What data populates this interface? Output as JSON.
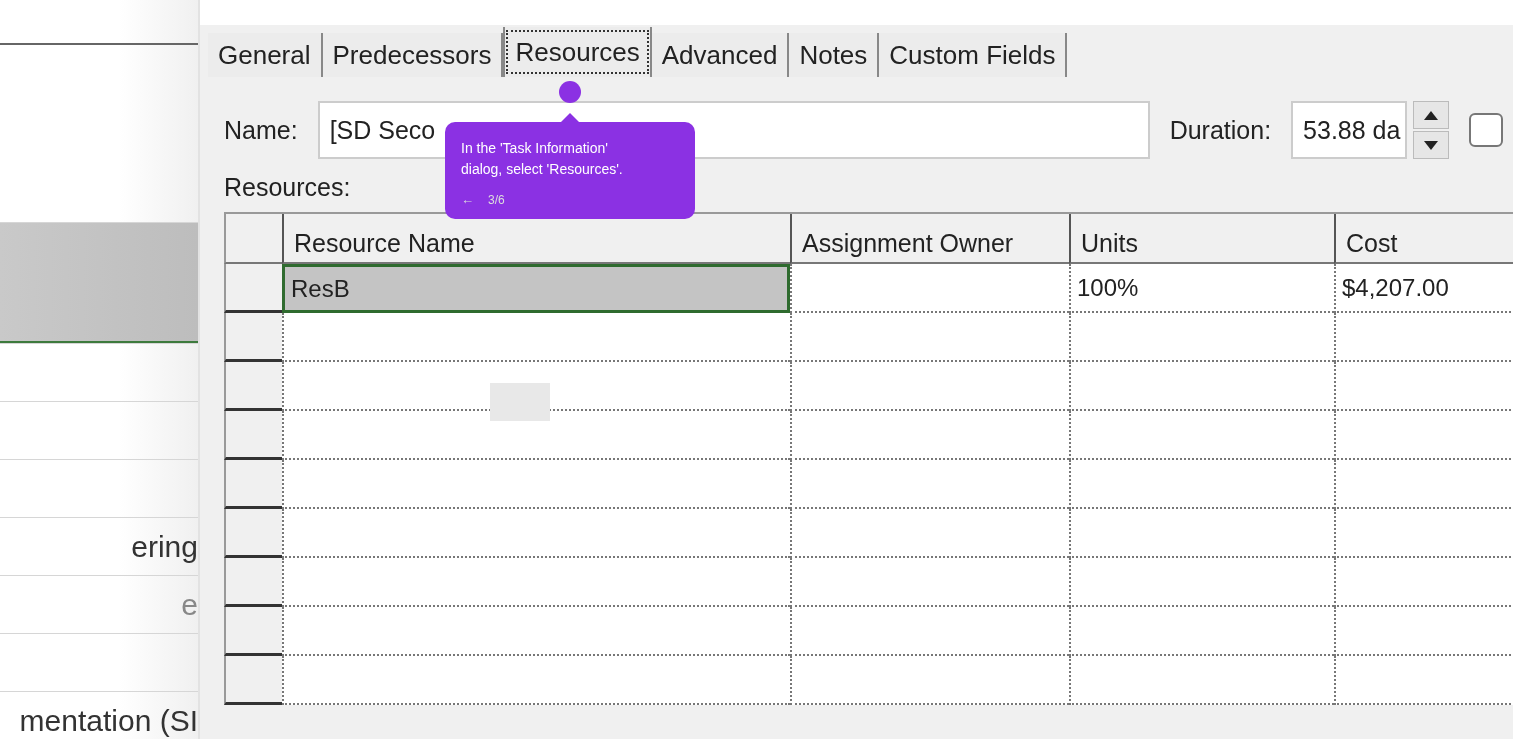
{
  "background_list": {
    "rows": [
      {
        "text": "",
        "selected": false
      },
      {
        "text": "",
        "selected": true
      },
      {
        "text": "",
        "selected": false
      },
      {
        "text": "",
        "selected": false
      },
      {
        "text": "",
        "selected": false
      },
      {
        "text": "ering",
        "selected": false
      },
      {
        "text": "e",
        "selected": false
      },
      {
        "text": "",
        "selected": false
      },
      {
        "text": "mentation (SI",
        "selected": false
      }
    ]
  },
  "tabs": [
    {
      "label": "General",
      "selected": false
    },
    {
      "label": "Predecessors",
      "selected": false
    },
    {
      "label": "Resources",
      "selected": true
    },
    {
      "label": "Advanced",
      "selected": false
    },
    {
      "label": "Notes",
      "selected": false
    },
    {
      "label": "Custom Fields",
      "selected": false
    }
  ],
  "name_field": {
    "label": "Name:",
    "value": "[SD Seco"
  },
  "duration_field": {
    "label": "Duration:",
    "value": "53.88 da"
  },
  "estimated_checkbox": {
    "checked": false
  },
  "resources_label": "Resources:",
  "table": {
    "columns": [
      "Resource Name",
      "Assignment Owner",
      "Units",
      "Cost"
    ],
    "rows": [
      {
        "cells": [
          "ResB",
          "",
          "100%",
          "$4,207.00"
        ],
        "selected": true
      }
    ]
  },
  "tooltip": {
    "text": "In the 'Task Information' dialog, select 'Resources'.",
    "back": "←",
    "step": "3/6"
  }
}
